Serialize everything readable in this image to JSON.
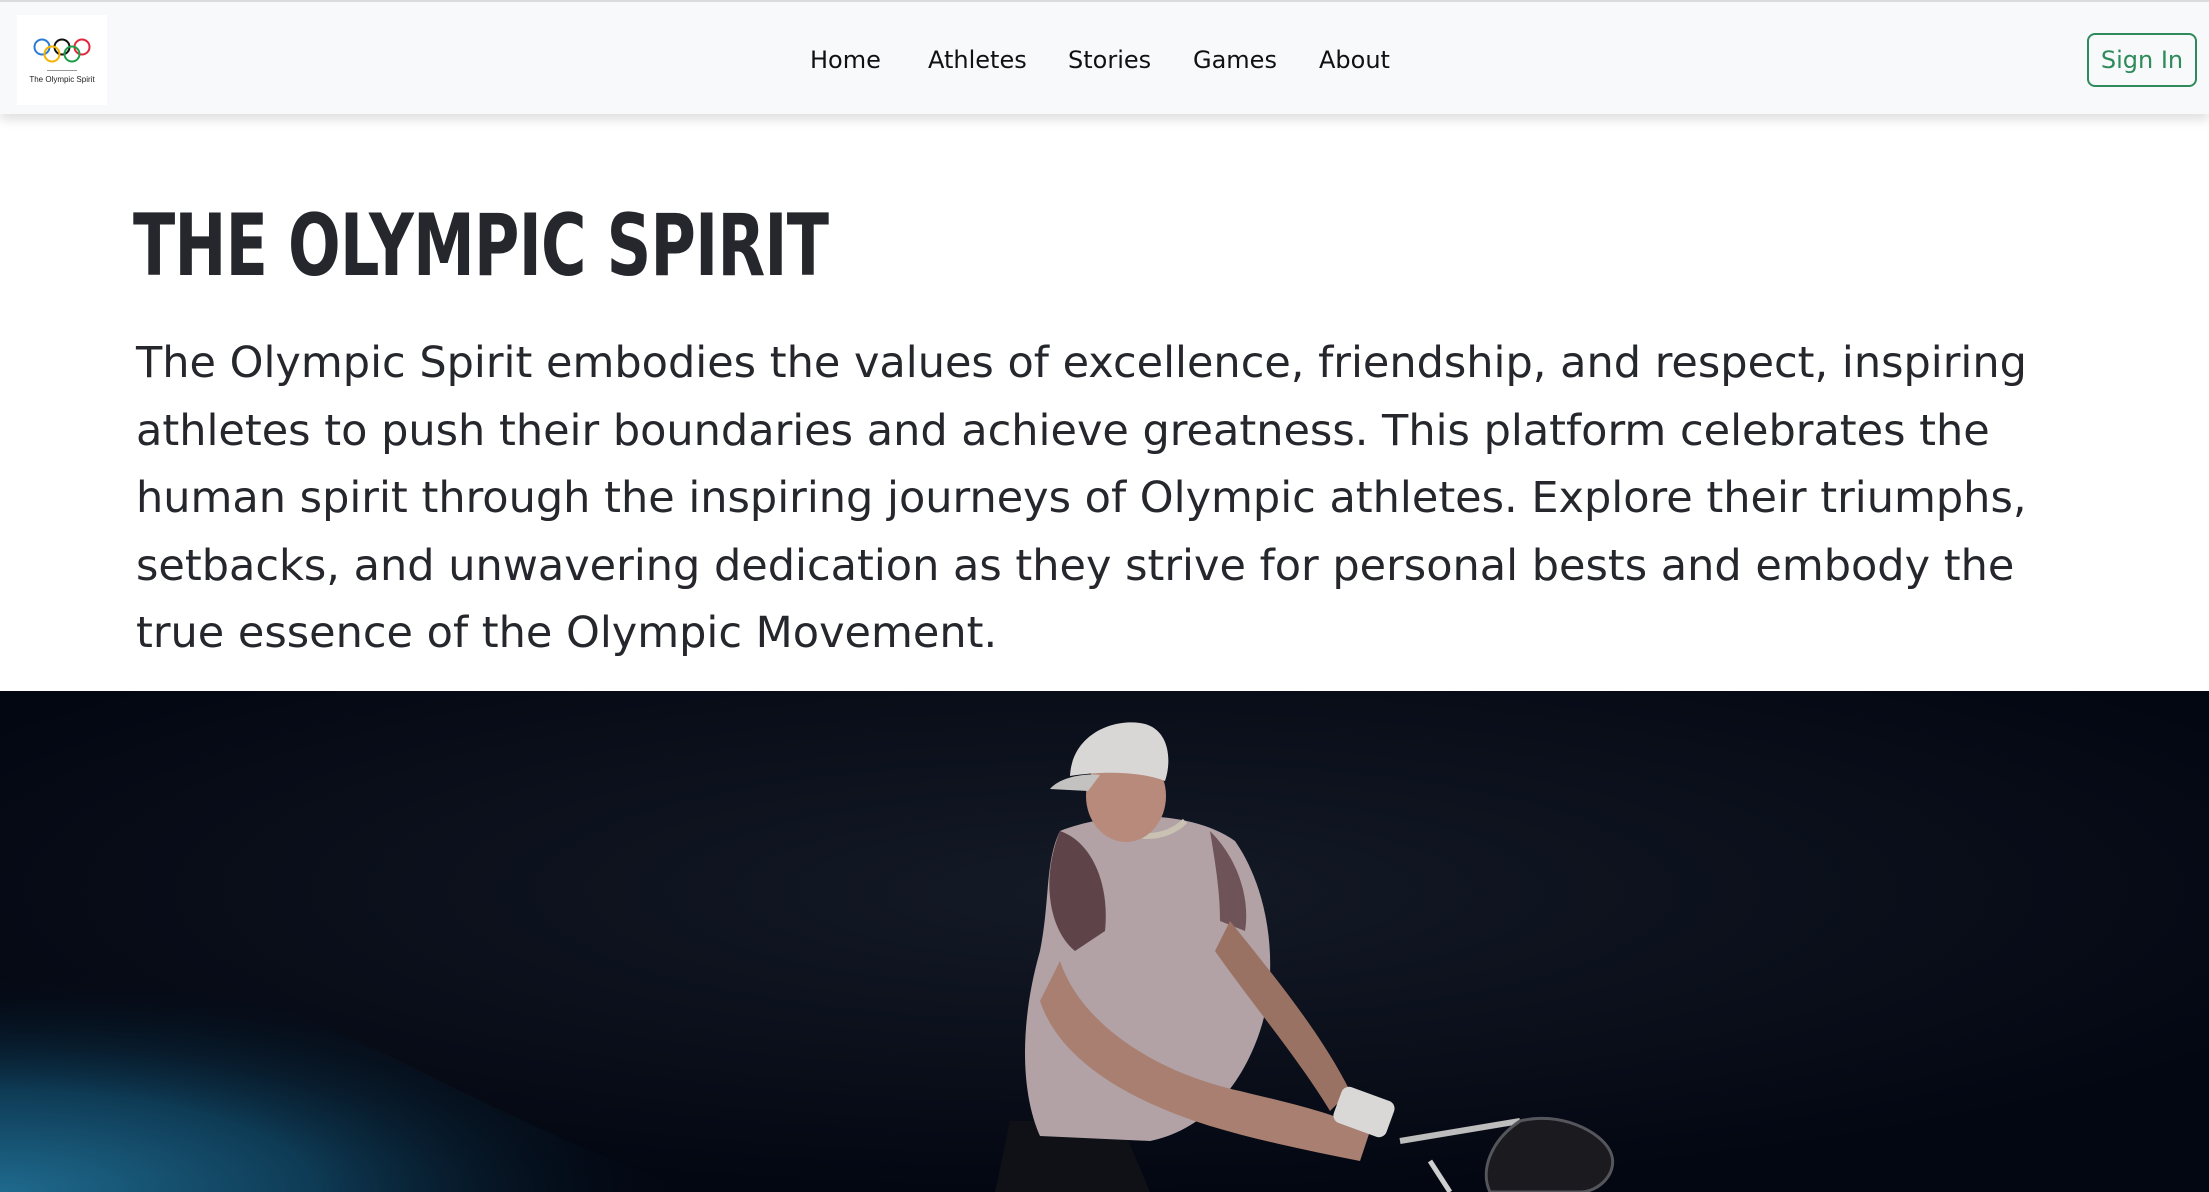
{
  "navbar": {
    "logo": {
      "icon": "olympic-rings-icon",
      "text": "The Olympic Spirit"
    },
    "links": [
      {
        "label": "Home"
      },
      {
        "label": "Athletes"
      },
      {
        "label": "Stories"
      },
      {
        "label": "Games"
      },
      {
        "label": "About"
      }
    ],
    "sign_in_label": "Sign In"
  },
  "hero": {
    "title": "THE OLYMPIC SPIRIT",
    "description": "The Olympic Spirit embodies the values of excellence, friendship, and respect, inspiring athletes to push their boundaries and achieve greatness. This platform celebrates the human spirit through the inspiring journeys of Olympic athletes. Explore their triumphs, setbacks, and unwavering dedication as they strive for personal bests and embody the true essence of the Olympic Movement."
  },
  "colors": {
    "accent": "#2f8a5c",
    "navbar_bg": "#f8f9fa",
    "text": "#25272c",
    "hero_image_bg": "#030712"
  }
}
